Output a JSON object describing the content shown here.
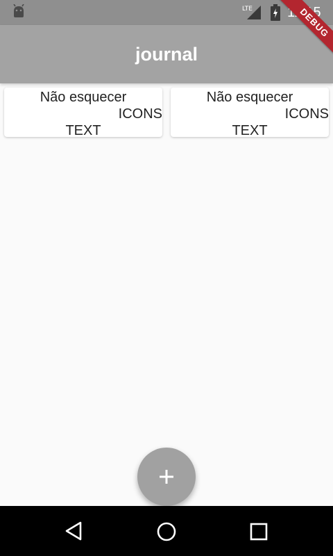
{
  "status_bar": {
    "time": "11:15",
    "network": "LTE",
    "icons": [
      "android-icon",
      "lte-signal-icon",
      "battery-charging-icon"
    ]
  },
  "app_bar": {
    "title": "journal"
  },
  "debug_banner": {
    "label": "DEBUG"
  },
  "cards": [
    {
      "title": "Não esquecer",
      "icons": "ICONS",
      "text": "TEXT"
    },
    {
      "title": "Não esquecer",
      "icons": "ICONS",
      "text": "TEXT"
    }
  ],
  "fab": {
    "icon": "plus-icon"
  },
  "nav_bar": {
    "icons": [
      "back-icon",
      "home-icon",
      "recents-icon"
    ]
  },
  "colors": {
    "status_bar": "#8f8f8f",
    "app_bar": "#a3a3a3",
    "background": "#fafafa",
    "card": "#ffffff",
    "fab": "#a1a1a1",
    "debug_banner": "#b3262f",
    "nav_bar": "#000000"
  }
}
